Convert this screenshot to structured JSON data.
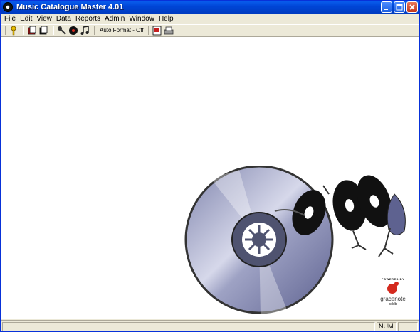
{
  "window": {
    "title": "Music Catalogue Master 4.01"
  },
  "menu": [
    "File",
    "Edit",
    "View",
    "Data",
    "Reports",
    "Admin",
    "Window",
    "Help"
  ],
  "toolbar": {
    "autoformat_label": "Auto Format - Off"
  },
  "logo": {
    "powered_by": "POWERED BY",
    "name": "gracenote",
    "sub": "cddb"
  },
  "statusbar": {
    "num": "NUM"
  },
  "colors": {
    "title_blue": "#0a5fef",
    "chrome": "#ece9d8",
    "logo_red": "#d42a1e"
  }
}
